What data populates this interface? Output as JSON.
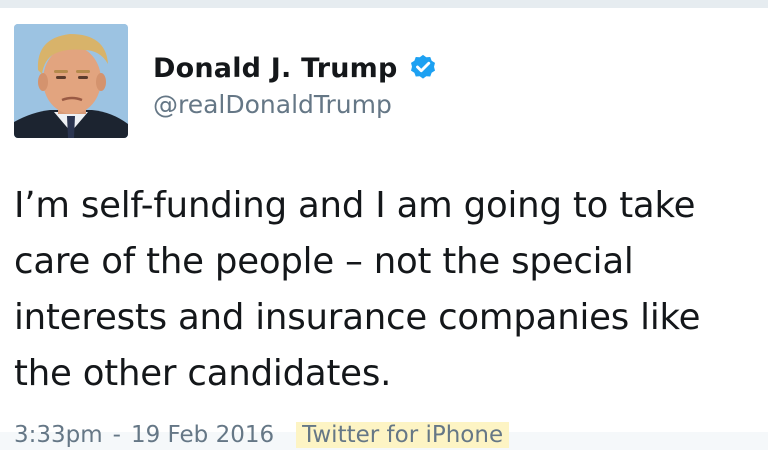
{
  "author": {
    "display_name": "Donald J. Trump",
    "handle": "@realDonaldTrump",
    "verified_icon": "verified-badge-icon",
    "avatar": "profile-photo"
  },
  "tweet": {
    "text": "I’m self-funding and I am going to take care of the people – not the special interests and insurance companies like the other candidates.",
    "time": "3:33pm",
    "separator": "-",
    "date": "19 Feb 2016",
    "source": "Twitter for iPhone"
  },
  "colors": {
    "verified_blue": "#1da1f2",
    "secondary_text": "#657786",
    "source_highlight": "#fdf4c4"
  }
}
